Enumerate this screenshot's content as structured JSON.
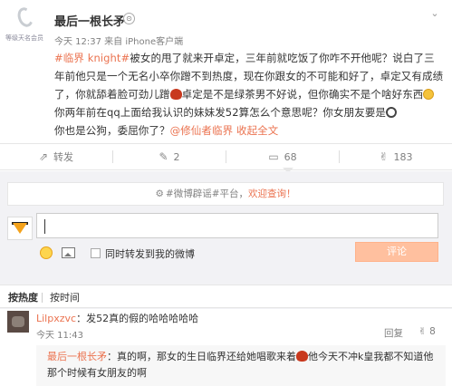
{
  "post": {
    "avatar_caption": "等级天名会员",
    "username": "最后一根长矛",
    "badge": "⊙",
    "meta": "今天 12:37 来自 iPhone客户端",
    "body": {
      "tag": "#临界 knight#",
      "text1": "被女的甩了就来开卓定，三年前就吃饭了你咋不开他呢？说白了三年前他只是一个无名小卒你蹭不到热度，现在你跟女的不可能和好了，卓定又有成绩了，你就舔着脸可劲儿蹭",
      "text2": "卓定是不是绿茶男不好说，但你确实不是个啥好东西",
      "text3": "你两年前在qq上面给我认识的妹妹发52算怎么个意思呢？你女朋友要是",
      "text4": "你也是公狗，委屈你了？",
      "link": "@修仙者临界",
      "expand": "收起全文"
    }
  },
  "actions": {
    "repost_icon": "⇗",
    "repost": "转发",
    "edit_icon": "✎",
    "edit": "2",
    "comment_icon": "▭",
    "comment": "68",
    "like_icon": "✌",
    "like": "183"
  },
  "comment_panel": {
    "notice_icon": "⚙",
    "notice_tag": "#微博辟谣#",
    "notice_text": "平台，",
    "notice_link": "欢迎查询！",
    "forward_label": "同时转发到我的微博",
    "submit": "评论"
  },
  "sort": {
    "hot": "按热度",
    "time": "按时间"
  },
  "comments": [
    {
      "user": "Lilpxzvc",
      "text": "：发52真的假的哈哈哈哈哈",
      "time": "今天 11:43",
      "reply_label": "回复",
      "like_icon": "✌",
      "like_count": "8",
      "sub_reply": {
        "user": "最后一根长矛",
        "text1": "：真的啊，那女的生日临界还给她唱歌来着",
        "text2": "他今天不冲k皇我都不知道他那个时候有女朋友的啊"
      }
    }
  ],
  "colors": {
    "accent": "#eb7350",
    "submit_bg": "#ffc09f",
    "panel_bg": "#f2f2f5"
  }
}
